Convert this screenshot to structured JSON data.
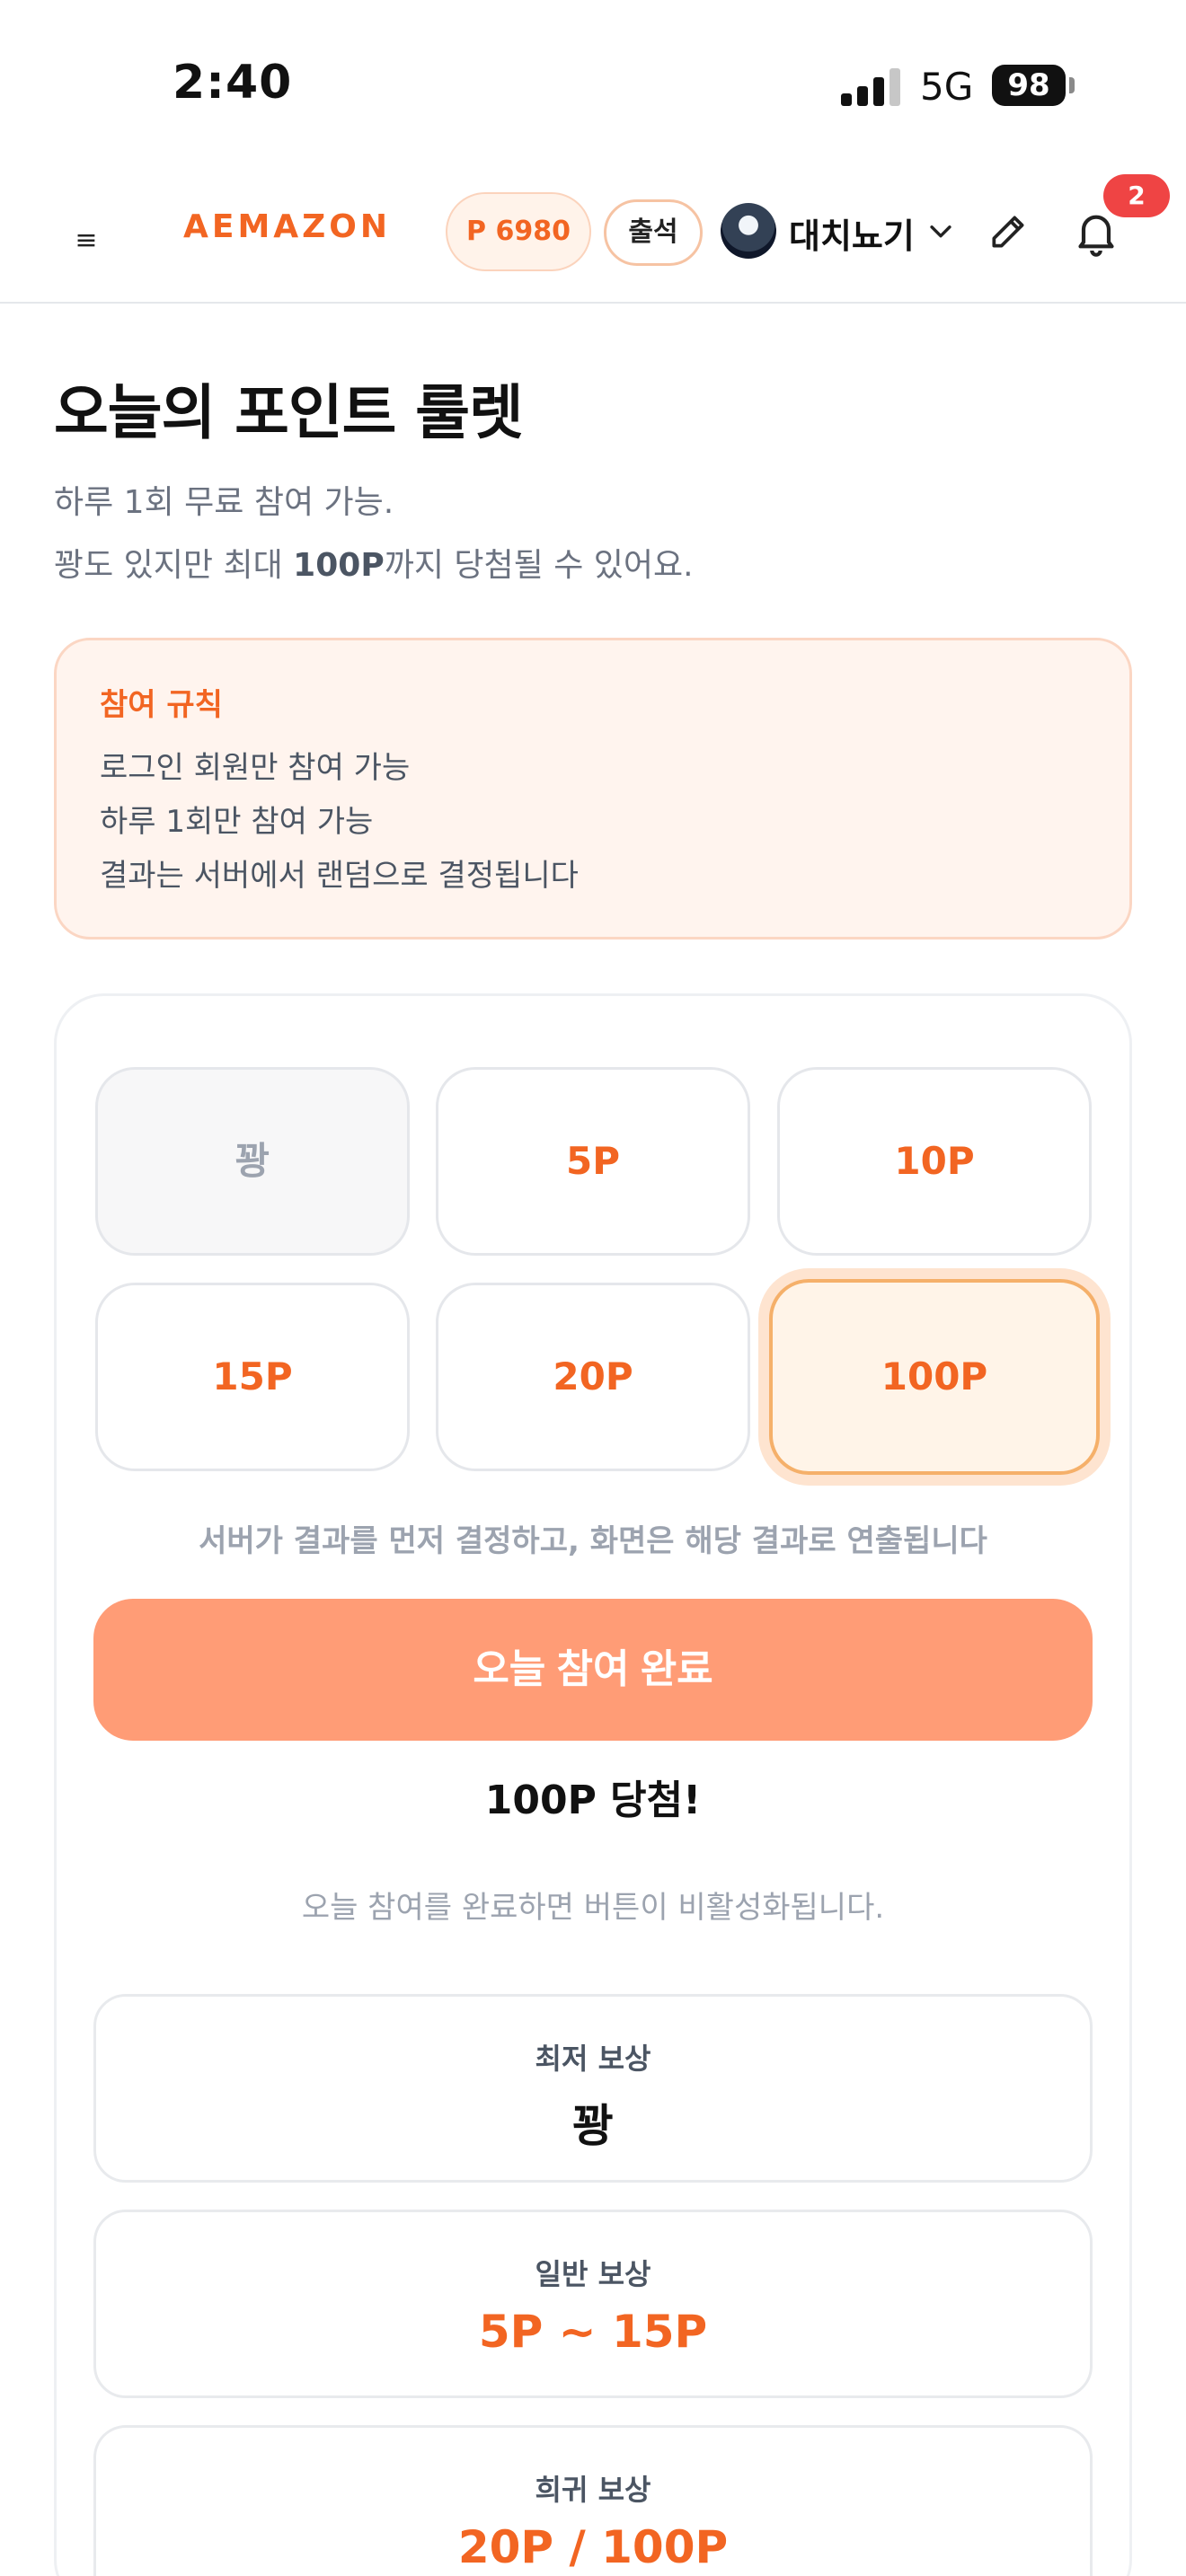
{
  "status_bar": {
    "time": "2:40",
    "network": "5G",
    "battery": "98"
  },
  "header": {
    "menu_glyph": "≡",
    "brand": "AEMAZON",
    "points": "P 6980",
    "attendance": "출석",
    "username": "대치뇨기",
    "notification_count": "2"
  },
  "page": {
    "title": "오늘의 포인트 룰렛",
    "desc_line1": "하루 1회 무료 참여 가능.",
    "desc_line2_prefix": "꽝도 있지만 최대 ",
    "desc_line2_bold": "100P",
    "desc_line2_suffix": "까지 당첨될 수 있어요."
  },
  "rules": {
    "title": "참여 규칙",
    "items": [
      "로그인 회원만 참여 가능",
      "하루 1회만 참여 가능",
      "결과는 서버에서 랜덤으로 결정됩니다"
    ]
  },
  "roulette": {
    "tiles": [
      "꽝",
      "5P",
      "10P",
      "15P",
      "20P",
      "100P"
    ],
    "selected_tile": "100P",
    "note": "서버가 결과를 먼저 결정하고, 화면은 해당 결과로 연출됩니다",
    "button_label": "오늘 참여 완료",
    "result": "100P 당첨!",
    "helper": "오늘 참여를 완료하면 버튼이 비활성화됩니다."
  },
  "rewards": [
    {
      "label": "최저 보상",
      "value": "꽝"
    },
    {
      "label": "일반 보상",
      "value": "5P ~ 15P"
    },
    {
      "label": "희귀 보상",
      "value": "20P / 100P"
    }
  ],
  "colors": {
    "accent": "#f26522",
    "button": "#ff9c76",
    "badge": "#ef4444"
  }
}
